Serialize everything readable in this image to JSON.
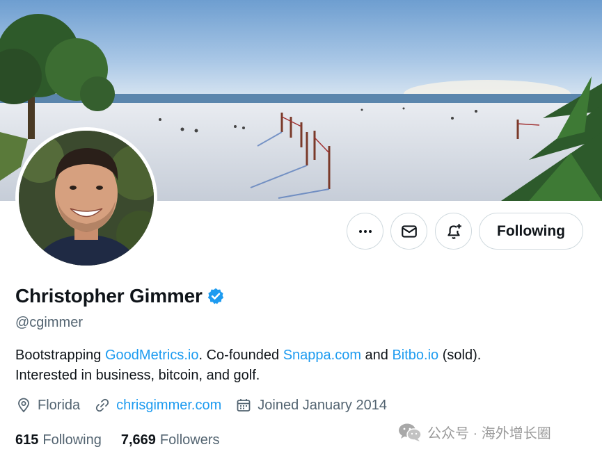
{
  "profile": {
    "name": "Christopher Gimmer",
    "handle": "@cgimmer",
    "verified": true,
    "bio": {
      "part1": "Bootstrapping ",
      "link1": "GoodMetrics.io",
      "part2": ". Co-founded ",
      "link2": "Snappa.com",
      "part3": " and ",
      "link3": "Bitbo.io",
      "part4": " (sold).",
      "line2": "Interested in business, bitcoin, and golf."
    },
    "location": "Florida",
    "website": "chrisgimmer.com",
    "joined": "Joined January 2014",
    "following_count": "615",
    "following_label": "Following",
    "followers_count": "7,669",
    "followers_label": "Followers"
  },
  "actions": {
    "more_icon": "more-icon",
    "message_icon": "mail-icon",
    "notify_icon": "bell-plus-icon",
    "following_button": "Following"
  },
  "watermark": {
    "text": "公众号 · 海外增长圈"
  },
  "colors": {
    "link": "#1d9bf0",
    "text": "#0f1419",
    "secondary": "#536471",
    "border": "#cfd9de",
    "verified": "#1d9bf0"
  }
}
